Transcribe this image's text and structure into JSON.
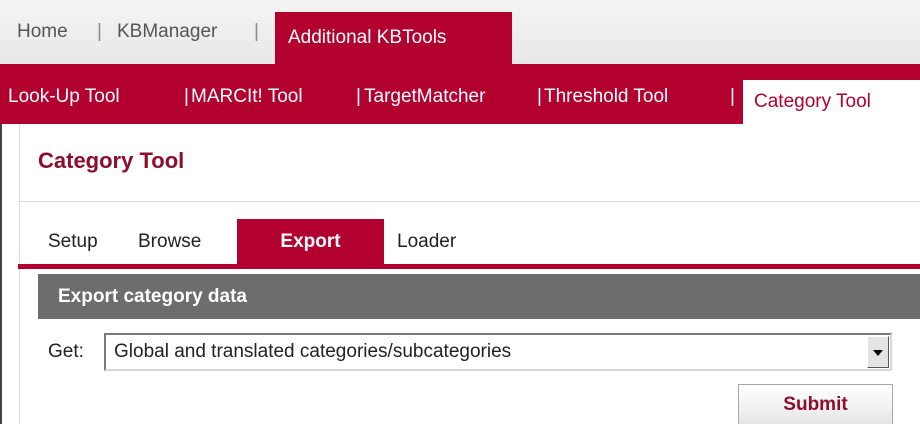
{
  "top_nav": {
    "items": [
      {
        "label": "Home"
      },
      {
        "label": "KBManager"
      },
      {
        "label": "Additional KBTools",
        "active": true
      }
    ],
    "separator": "|"
  },
  "sub_nav": {
    "items": [
      {
        "label": "Look-Up Tool"
      },
      {
        "label": "MARCIt! Tool"
      },
      {
        "label": "TargetMatcher"
      },
      {
        "label": "Threshold Tool"
      },
      {
        "label": "Category Tool",
        "active": true
      }
    ],
    "separator": "|"
  },
  "page": {
    "title": "Category Tool"
  },
  "tabs": [
    {
      "label": "Setup"
    },
    {
      "label": "Browse"
    },
    {
      "label": "Export",
      "active": true
    },
    {
      "label": "Loader"
    }
  ],
  "export": {
    "header": "Export category data",
    "get_label": "Get:",
    "selected": "Global and translated categories/subcategories",
    "submit_label": "Submit"
  },
  "colors": {
    "brand": "#b2002f",
    "title": "#8e0d2c",
    "section_header": "#6d6d6d"
  }
}
